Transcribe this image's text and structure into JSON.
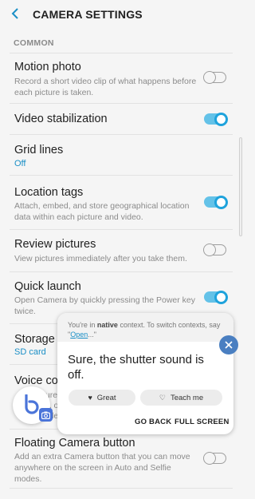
{
  "header": {
    "back_icon": "back-chevron-icon",
    "title": "CAMERA SETTINGS"
  },
  "section_common": "COMMON",
  "settings": [
    {
      "label": "Motion photo",
      "description": "Record a short video clip of what happens before each picture is taken.",
      "toggle": false
    },
    {
      "label": "Video stabilization",
      "toggle": true
    },
    {
      "label": "Grid lines",
      "value": "Off"
    },
    {
      "label": "Location tags",
      "description": "Attach, embed, and store geographical location data within each picture and video.",
      "toggle": true
    },
    {
      "label": "Review pictures",
      "description": "View pictures immediately after you take them.",
      "toggle": false
    },
    {
      "label": "Quick launch",
      "description": "Open Camera by quickly pressing the Power key twice.",
      "toggle": true
    },
    {
      "label": "Storage l",
      "value": "SD card"
    },
    {
      "label": "Voice co",
      "description_frag_1": "ture",
      "description_frag_2": "\", o",
      "description_frag_3": "vide"
    },
    {
      "label": "Floating Camera button",
      "description": "Add an extra Camera button that you can move anywhere on the screen in Auto and Selfie modes.",
      "toggle": false
    }
  ],
  "bixby_popup": {
    "hint_prefix": "You're in ",
    "hint_bold": "native",
    "hint_middle": " context. To switch contexts, say \"",
    "hint_link": "Open",
    "hint_suffix": "...\"",
    "answer": "Sure, the shutter sound is off.",
    "chip_great": "Great",
    "chip_teach": "Teach me",
    "go_back": "GO BACK",
    "full_screen": "FULL SCREEN"
  },
  "colors": {
    "accent": "#1a8fc6",
    "toggle_on": "#1fa3dc",
    "bixby_blue": "#4a74d9"
  }
}
